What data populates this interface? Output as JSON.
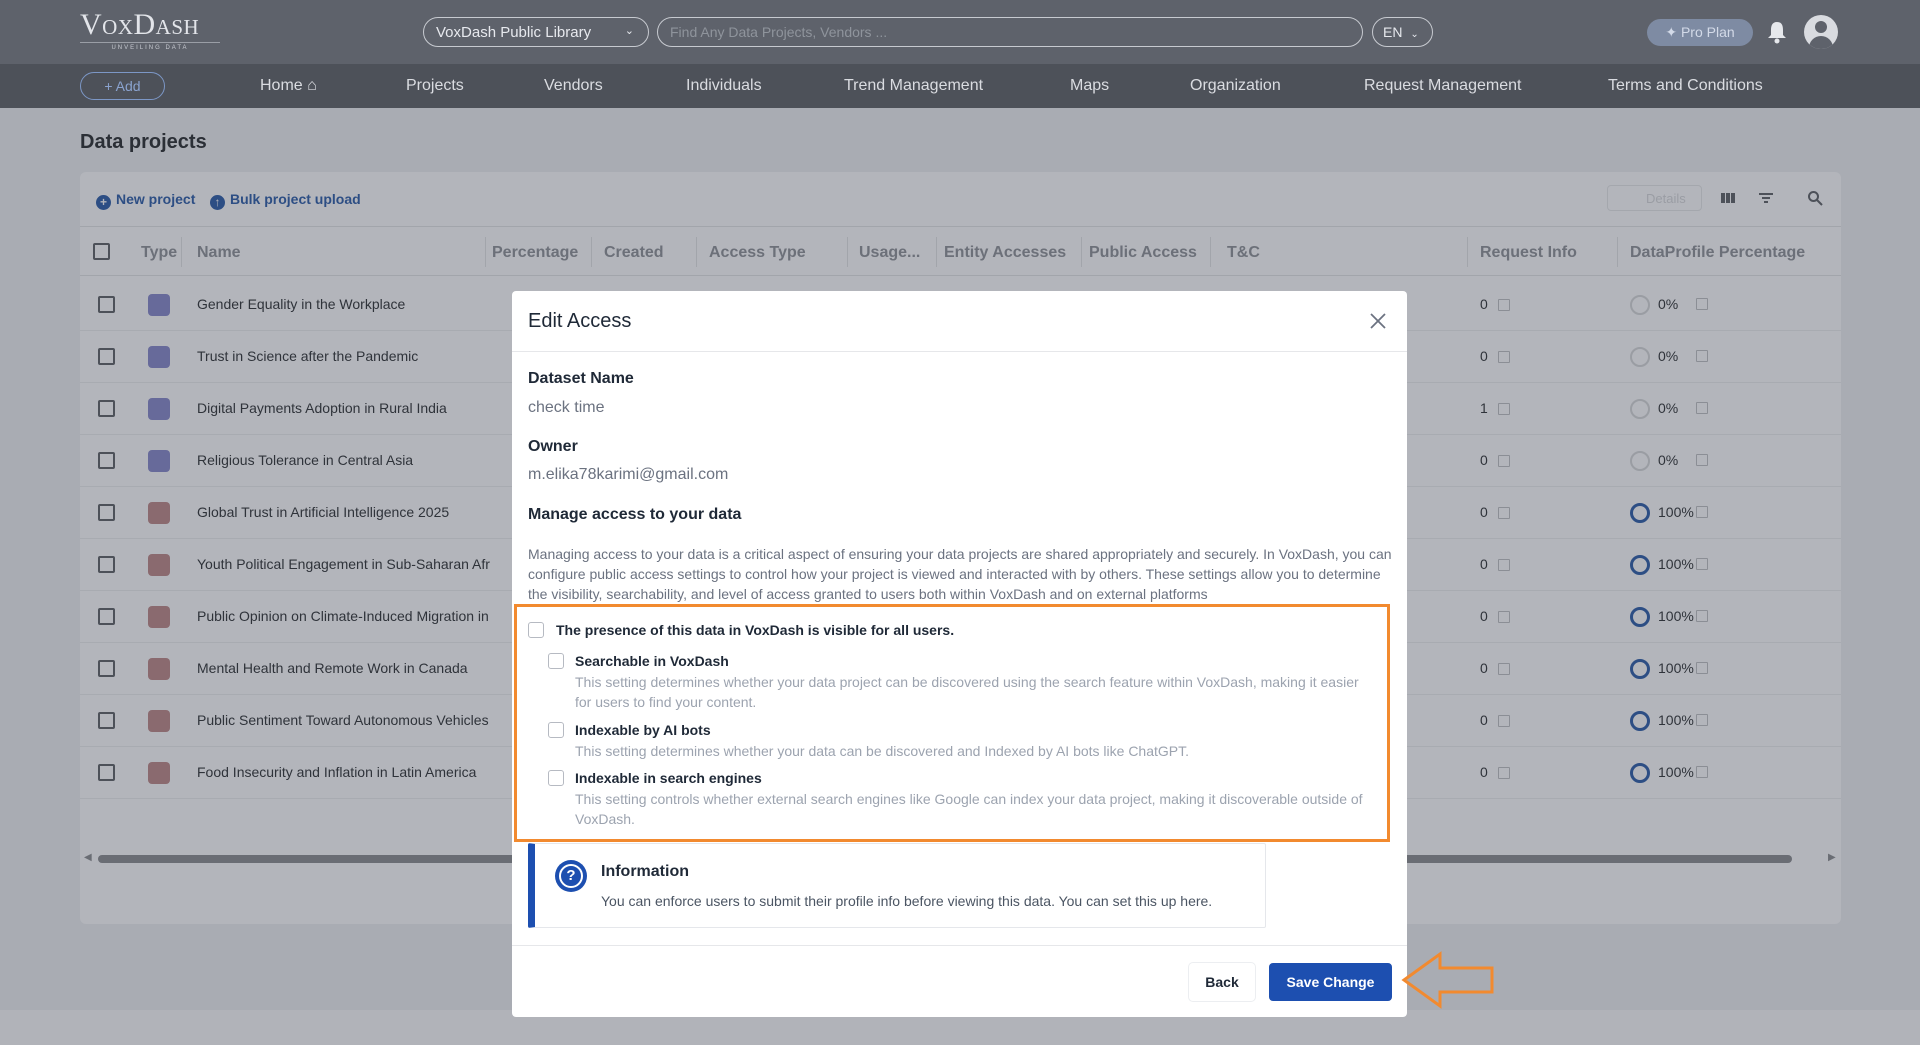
{
  "header": {
    "logo_main": "VoxDash",
    "logo_tagline": "UNVEILING DATA",
    "library_select": "VoxDash Public Library",
    "search_placeholder": "Find Any Data Projects, Vendors ...",
    "language": "EN",
    "pro_plan": "✦ Pro Plan"
  },
  "nav": {
    "add_label": "+ Add",
    "items": [
      "Home",
      "Projects",
      "Vendors",
      "Individuals",
      "Trend Management",
      "Maps",
      "Organization",
      "Request Management",
      "Terms and Conditions"
    ]
  },
  "page": {
    "title": "Data projects",
    "new_project": "New project",
    "bulk_upload": "Bulk project upload",
    "details": "Details"
  },
  "table": {
    "columns": [
      "Type",
      "Name",
      "Percentage",
      "Created",
      "Access Type",
      "Usage...",
      "Entity Accesses",
      "Public Access",
      "T&C",
      "Request Info",
      "DataProfile Percentage"
    ],
    "rows": [
      {
        "type": "stack",
        "name": "Gender Equality in the Workplace",
        "request_info": "0",
        "percent": "0%",
        "full": false
      },
      {
        "type": "stack",
        "name": "Trust in Science after the Pandemic",
        "request_info": "0",
        "percent": "0%",
        "full": false
      },
      {
        "type": "stack",
        "name": "Digital Payments Adoption in Rural India",
        "request_info": "1",
        "percent": "0%",
        "full": false
      },
      {
        "type": "stack",
        "name": "Religious Tolerance in Central Asia",
        "request_info": "0",
        "percent": "0%",
        "full": false
      },
      {
        "type": "globe",
        "name": "Global Trust in Artificial Intelligence 2025",
        "request_info": "0",
        "percent": "100%",
        "full": true
      },
      {
        "type": "globe",
        "name": "Youth Political Engagement in Sub-Saharan Afr",
        "request_info": "0",
        "percent": "100%",
        "full": true
      },
      {
        "type": "globe",
        "name": "Public Opinion on Climate-Induced Migration in",
        "request_info": "0",
        "percent": "100%",
        "full": true
      },
      {
        "type": "globe",
        "name": "Mental Health and Remote Work in Canada",
        "request_info": "0",
        "percent": "100%",
        "full": true
      },
      {
        "type": "globe",
        "name": "Public Sentiment Toward Autonomous Vehicles",
        "request_info": "0",
        "percent": "100%",
        "full": true
      },
      {
        "type": "globe",
        "name": "Food Insecurity and Inflation in Latin America",
        "request_info": "0",
        "percent": "100%",
        "full": true
      }
    ]
  },
  "modal": {
    "title": "Edit Access",
    "dataset_name_label": "Dataset Name",
    "dataset_name": "check time",
    "owner_label": "Owner",
    "owner": "m.elika78karimi@gmail.com",
    "manage_title": "Manage access to your data",
    "manage_desc": "Managing access to your data is a critical aspect of ensuring your data projects are shared appropriately and securely. In VoxDash, you can configure public access settings to control how your project is viewed and interacted with by others. These settings allow you to determine the visibility, searchability, and level of access granted to users both within VoxDash and on external platforms",
    "visibility_option": "The presence of this data in VoxDash is visible for all users.",
    "options": [
      {
        "title": "Searchable in VoxDash",
        "desc": "This setting determines whether your data project can be discovered using the search feature within VoxDash, making it easier for users to find your content."
      },
      {
        "title": "Indexable by AI bots",
        "desc": "This setting determines whether your data can be discovered and Indexed by AI bots like ChatGPT."
      },
      {
        "title": "Indexable in search engines",
        "desc": "This setting controls whether external search engines like Google can index your data project, making it discoverable outside of VoxDash."
      }
    ],
    "info_title": "Information",
    "info_text": "You can enforce users to submit their profile info before viewing this data. You can set this up here.",
    "back_label": "Back",
    "save_label": "Save Change"
  },
  "colors": {
    "primary": "#1d4fb0",
    "highlight": "#f28a2f",
    "overlay": "#a9acb3"
  }
}
